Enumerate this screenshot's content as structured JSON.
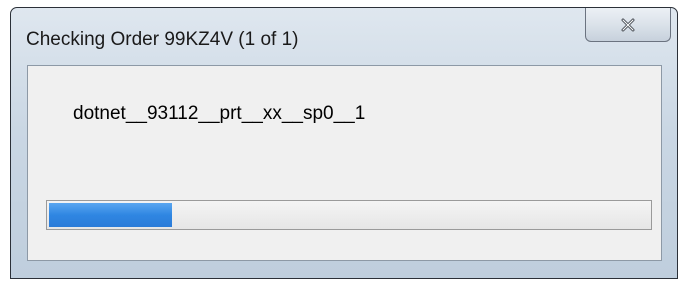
{
  "window": {
    "title": "Checking Order 99KZ4V (1 of 1)",
    "close_icon": "close-icon"
  },
  "content": {
    "filename": "dotnet__93112__prt__xx__sp0__1"
  },
  "progress": {
    "fraction": 0.205,
    "color": "#2f86e2"
  },
  "colors": {
    "frame": "#c8d6e4",
    "client_bg": "#f0f0f0"
  }
}
